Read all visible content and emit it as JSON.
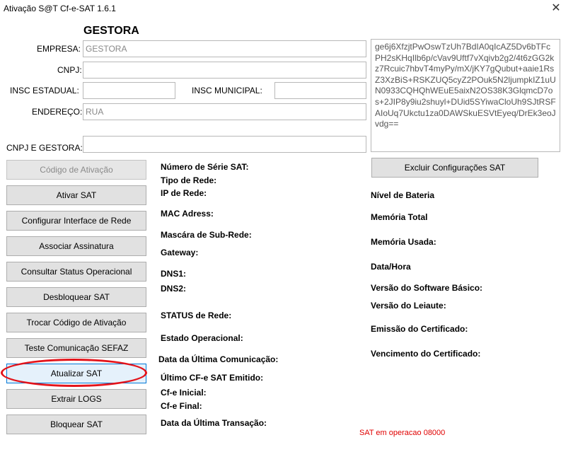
{
  "window": {
    "title": "Ativação S@T Cf-e-SAT 1.6.1",
    "close_glyph": "✕"
  },
  "company_heading": "GESTORA",
  "form": {
    "empresa_label": "EMPRESA:",
    "empresa_value": "GESTORA",
    "cnpj_label": "CNPJ:",
    "cnpj_value": "",
    "insc_estadual_label": "INSC ESTADUAL:",
    "insc_estadual_value": "",
    "insc_municipal_label": "INSC MUNICIPAL:",
    "insc_municipal_value": "",
    "endereco_label": "ENDEREÇO:",
    "endereco_value": "RUA",
    "cnpj_gestora_label": "CNPJ E GESTORA:",
    "cnpj_gestora_value": ""
  },
  "certificate_text": "ge6j6XfzjtPwOswTzUh7BdIA0qIcAZ5Dv6bTFcPH2sKHqIlb6p/cVav9Uftf7vXqivb2g2/4t6zGG2kz7Rcuic7hbvT4myPy/mX/jKY7gQubut+aaie1RsZ3XzBiS+RSKZUQ5cyZ2POuk5N2ljumpkIZ1uUN0933CQHQhWEuE5aixN2OS38K3GlqmcD7os+2JIP8y9iu2shuyl+DUid5SYiwaCloUh9SJtRSFAIoUq7Ukctu1za0DAWSkuESVtEyeq/DrEk3eoJvdg==",
  "buttons": [
    {
      "label": "Código de Ativação",
      "state": "disabled"
    },
    {
      "label": "Ativar SAT",
      "state": "normal"
    },
    {
      "label": "Configurar Interface de Rede",
      "state": "normal"
    },
    {
      "label": "Associar Assinatura",
      "state": "normal"
    },
    {
      "label": "Consultar Status Operacional",
      "state": "normal"
    },
    {
      "label": "Desbloquear SAT",
      "state": "normal"
    },
    {
      "label": "Trocar Código de Ativação",
      "state": "normal"
    },
    {
      "label": "Teste Comunicação SEFAZ",
      "state": "normal"
    },
    {
      "label": "Atualizar SAT",
      "state": "focused"
    },
    {
      "label": "Extrair LOGS",
      "state": "normal"
    },
    {
      "label": "Bloquear SAT",
      "state": "normal"
    }
  ],
  "excluir_button": "Excluir Configurações SAT",
  "info_left": [
    "Número de Série SAT:",
    "Tipo de Rede:",
    "IP de Rede:",
    "MAC Adress:",
    "Mascára de Sub-Rede:",
    "Gateway:",
    "DNS1:",
    "DNS2:",
    "STATUS de Rede:",
    "Estado Operacional:",
    "Data da Última Comunicação:",
    "Último CF-e SAT Emitido:",
    "Cf-e Inicial:",
    "Cf-e Final:",
    "Data da Última Transação:"
  ],
  "info_right": [
    "Nível de Bateria",
    "Memória Total",
    "Memória Usada:",
    "Data/Hora",
    "Versão do Software Básico:",
    "Versão do Leiaute:",
    "Emissão do Certificado:",
    "Vencimento do Certificado:"
  ],
  "status_message": "SAT em operacao 08000",
  "colors": {
    "highlight": "#e3141b",
    "status_message": "#e00000",
    "focus_border": "#0078d7"
  }
}
